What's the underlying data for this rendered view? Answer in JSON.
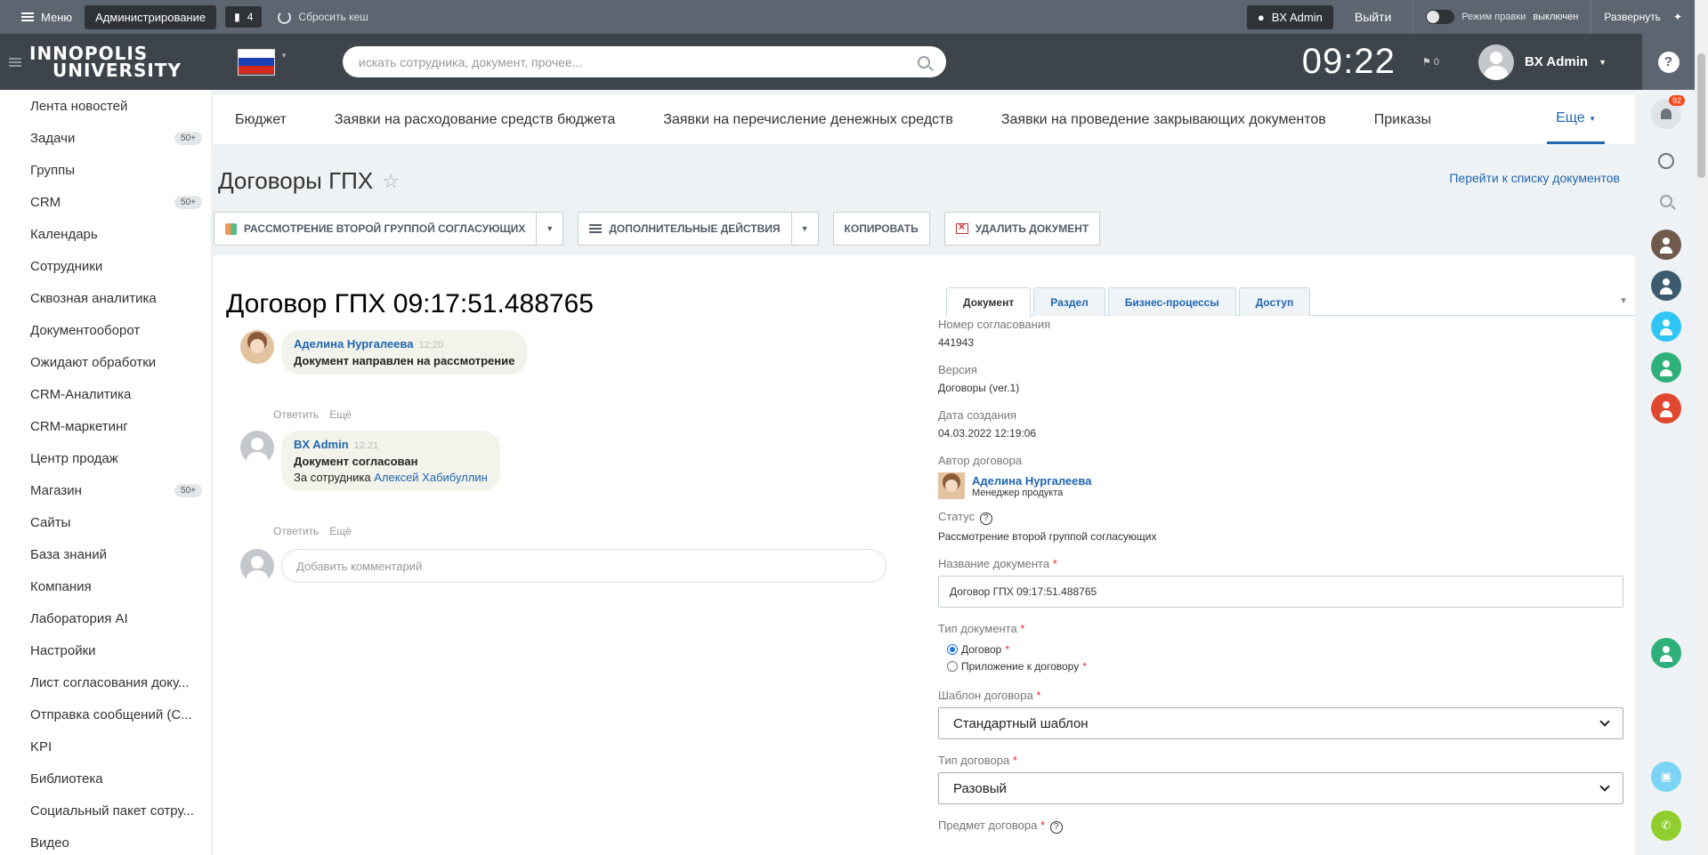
{
  "adminbar": {
    "menu_label": "Меню",
    "admin_label": "Администрирование",
    "counter": "4",
    "reset_cache": "Сбросить кеш",
    "user": "BX Admin",
    "exit": "Выйти",
    "edit_mode_label": "Режим правки",
    "edit_mode_state": "выключен",
    "expand": "Развернуть"
  },
  "header": {
    "logo_line1": "INNOPOLIS",
    "logo_line2": "UNIVERSITY",
    "search_placeholder": "искать сотрудника, документ, прочее...",
    "clock": "09:22",
    "flag_count": "0",
    "user_name": "BX Admin"
  },
  "sidebar": {
    "items": [
      {
        "label": "Лента новостей",
        "count": ""
      },
      {
        "label": "Задачи",
        "count": "50+"
      },
      {
        "label": "Группы",
        "count": ""
      },
      {
        "label": "CRM",
        "count": "50+"
      },
      {
        "label": "Календарь",
        "count": ""
      },
      {
        "label": "Сотрудники",
        "count": ""
      },
      {
        "label": "Сквозная аналитика",
        "count": ""
      },
      {
        "label": "Документооборот",
        "count": ""
      },
      {
        "label": "Ожидают обработки",
        "count": ""
      },
      {
        "label": "CRM-Аналитика",
        "count": ""
      },
      {
        "label": "CRM-маркетинг",
        "count": ""
      },
      {
        "label": "Центр продаж",
        "count": ""
      },
      {
        "label": "Магазин",
        "count": "50+"
      },
      {
        "label": "Сайты",
        "count": ""
      },
      {
        "label": "База знаний",
        "count": ""
      },
      {
        "label": "Компания",
        "count": ""
      },
      {
        "label": "Лаборатория AI",
        "count": ""
      },
      {
        "label": "Настройки",
        "count": ""
      },
      {
        "label": "Лист согласования доку...",
        "count": ""
      },
      {
        "label": "Отправка сообщений (С...",
        "count": ""
      },
      {
        "label": "KPI",
        "count": ""
      },
      {
        "label": "Библиотека",
        "count": ""
      },
      {
        "label": "Социальный пакет сотру...",
        "count": ""
      },
      {
        "label": "Видео",
        "count": ""
      }
    ]
  },
  "rightbar": {
    "notifications_badge": "92"
  },
  "topnav": {
    "items": [
      "Бюджет",
      "Заявки на расходование средств бюджета",
      "Заявки на перечисление денежных средств",
      "Заявки на проведение закрывающих документов",
      "Приказы"
    ],
    "more": "Еще"
  },
  "page": {
    "title": "Договоры ГПХ",
    "doc_list_link": "Перейти к списку документов"
  },
  "toolbar": {
    "btn_review": "Рассмотрение второй группой согласующих",
    "btn_actions": "Дополнительные действия",
    "btn_copy": "Копировать",
    "btn_delete": "Удалить документ"
  },
  "document": {
    "title": "Договор ГПХ 09:17:51.488765",
    "comments": [
      {
        "author": "Аделина Нургалеева",
        "time": "12:20",
        "text": "Документ направлен на рассмотрение",
        "sub_prefix": "",
        "sub_link": ""
      },
      {
        "author": "BX Admin",
        "time": "12:21",
        "text": "Документ согласован",
        "sub_prefix": "За сотрудника",
        "sub_link": "Алексей Хабибуллин"
      }
    ],
    "reply": "Ответить",
    "more": "Ещё",
    "add_comment_placeholder": "Добавить комментарий"
  },
  "tabs": [
    "Документ",
    "Раздел",
    "Бизнес-процессы",
    "Доступ"
  ],
  "fields": {
    "approval_number_label": "Номер согласования",
    "approval_number": "441943",
    "version_label": "Версия",
    "version": "Договоры (ver.1)",
    "created_label": "Дата создания",
    "created": "04.03.2022 12:19:06",
    "author_label": "Автор договора",
    "author_name": "Аделина Нургалеева",
    "author_position": "Менеджер продукта",
    "status_label": "Статус",
    "status": "Рассмотрение второй группой согласующих",
    "doc_name_label": "Название документа",
    "doc_name": "Договор ГПХ 09:17:51.488765",
    "doc_type_label": "Тип документа",
    "doc_type_opt1": "Договор",
    "doc_type_opt2": "Приложение к договору",
    "template_label": "Шаблон договора",
    "template": "Стандартный шаблон",
    "contract_type_label": "Тип договора",
    "contract_type": "Разовый",
    "subject_label": "Предмет договора"
  }
}
